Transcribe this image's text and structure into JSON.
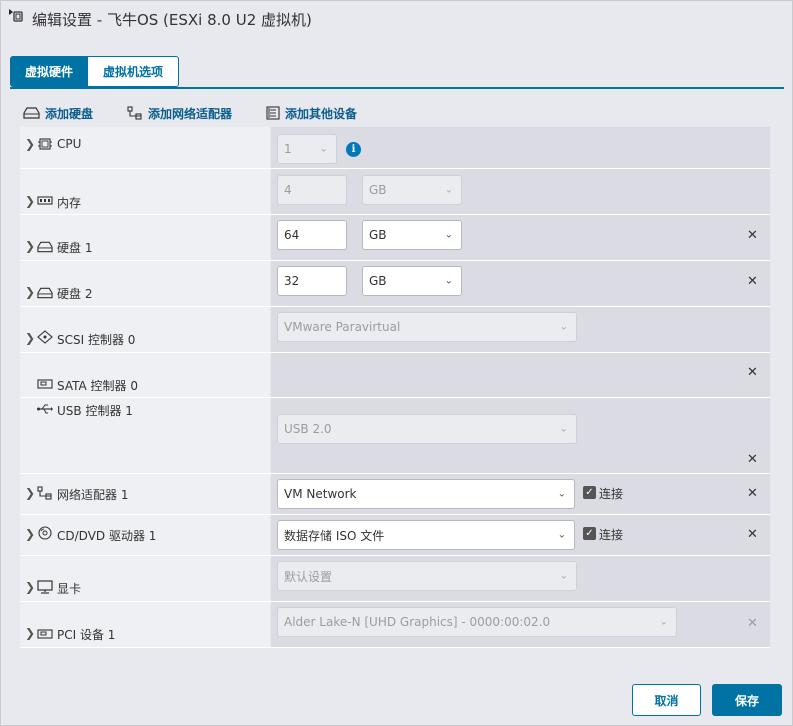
{
  "window": {
    "title": "编辑设置 - 飞牛OS (ESXi 8.0 U2 虚拟机)"
  },
  "tabs": [
    {
      "label": "虚拟硬件",
      "active": true
    },
    {
      "label": "虚拟机选项",
      "active": false
    }
  ],
  "toolbar": {
    "add_disk": "添加硬盘",
    "add_network_adapter": "添加网络适配器",
    "add_other_device": "添加其他设备"
  },
  "rows": {
    "cpu": {
      "label": "CPU",
      "value": "1"
    },
    "memory": {
      "label": "内存",
      "value": "4",
      "unit": "GB"
    },
    "disk1": {
      "label": "硬盘 1",
      "value": "64",
      "unit": "GB"
    },
    "disk2": {
      "label": "硬盘 2",
      "value": "32",
      "unit": "GB"
    },
    "scsi": {
      "label": "SCSI 控制器 0",
      "value": "VMware Paravirtual"
    },
    "sata": {
      "label": "SATA 控制器 0"
    },
    "usb": {
      "label": "USB 控制器 1",
      "value": "USB 2.0"
    },
    "network": {
      "label": "网络适配器 1",
      "value": "VM Network",
      "connect_label": "连接"
    },
    "cdrom": {
      "label": "CD/DVD 驱动器 1",
      "value": "数据存储 ISO 文件",
      "connect_label": "连接"
    },
    "video": {
      "label": "显卡",
      "value": "默认设置"
    },
    "pci": {
      "label": "PCI 设备 1",
      "value": "Alder Lake-N [UHD Graphics] - 0000:00:02.0"
    }
  },
  "footer": {
    "cancel": "取消",
    "save": "保存"
  },
  "colors": {
    "accent": "#0072a3",
    "info": "#0079b8"
  }
}
